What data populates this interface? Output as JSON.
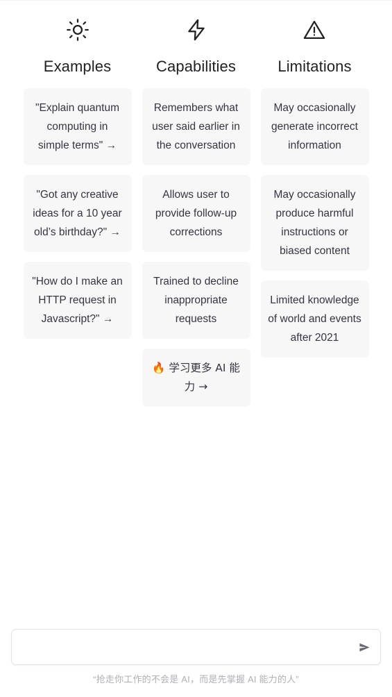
{
  "columns": [
    {
      "id": "examples",
      "icon": "sun-icon",
      "title": "Examples",
      "cards": [
        {
          "text": "\"Explain quantum computing in simple terms\" →",
          "interactable": true
        },
        {
          "text": "\"Got any creative ideas for a 10 year old’s birthday?\" →",
          "interactable": true
        },
        {
          "text": "\"How do I make an HTTP request in Javascript?\" →",
          "interactable": true
        }
      ]
    },
    {
      "id": "capabilities",
      "icon": "lightning-bolt-icon",
      "title": "Capabilities",
      "cards": [
        {
          "text": "Remembers what user said earlier in the conversation",
          "interactable": false
        },
        {
          "text": "Allows user to provide follow-up corrections",
          "interactable": false
        },
        {
          "text": "Trained to decline inappropriate requests",
          "interactable": false
        },
        {
          "text": "🔥 学习更多 AI 能力 →",
          "interactable": true
        }
      ]
    },
    {
      "id": "limitations",
      "icon": "warning-triangle-icon",
      "title": "Limitations",
      "cards": [
        {
          "text": "May occasionally generate incorrect information",
          "interactable": false
        },
        {
          "text": "May occasionally produce harmful instructions or biased content",
          "interactable": false
        },
        {
          "text": "Limited knowledge of world and events after 2021",
          "interactable": false
        }
      ]
    }
  ],
  "composer": {
    "value": "",
    "placeholder": "",
    "send_icon": "send-icon"
  },
  "footer": {
    "note": "“抢走你工作的不会是 AI，而是先掌握 AI 能力的人”"
  },
  "theme": {
    "background": "#ffffff",
    "card_background": "#f7f7f8",
    "text": "#343541",
    "muted": "#aeb0b6",
    "border": "#e3e3e6"
  }
}
